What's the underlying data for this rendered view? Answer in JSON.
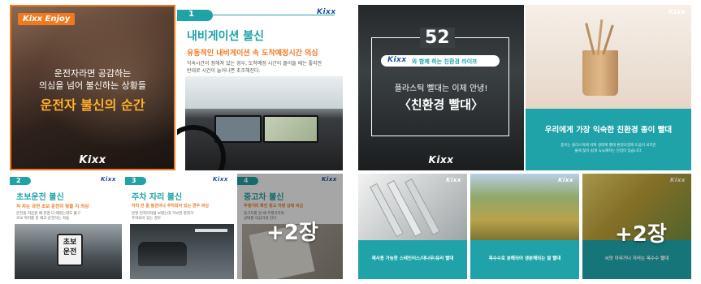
{
  "post_a": {
    "main": {
      "badge": "Kixx Enjoy",
      "subtitle_line1": "운전자라면 공감하는",
      "subtitle_line2": "의심을 넘어 불신하는 상황들",
      "title": "운전자 불신의 순간",
      "logo": "Kixx"
    },
    "card1": {
      "number": "1",
      "logo": "Kixx",
      "title": "내비게이션 불신",
      "highlight": "유동적인 내비게이션 속 도착예정시간 의심",
      "desc_line1": "익숙시간이 정해져 있는 경우, 도착예정 시간이 줄어들 때는 좋지만",
      "desc_line2": "반대로 시간이 늘어나면 초조해진다."
    },
    "card2": {
      "number": "2",
      "logo": "Kixx",
      "title": "초보운전 불신",
      "highlight": "저 차는 과연 초보 운전이 맞을 지 의심",
      "desc_line1": "운전을 처음할 때 분명 다 떼었는데도 불구",
      "desc_line2": "초보 딱지를 못 떼고 운전하는 차들",
      "sticker_line1": "초보",
      "sticker_line2": "운전"
    },
    "card3": {
      "number": "3",
      "logo": "Kixx",
      "title": "주차 자리 불신",
      "highlight": "자리 한 줄 발견이나 주차되어 있는 경우 의심",
      "desc_line1": "분명 빈자리처럼 보였는데 가보면 경차가",
      "desc_line2": "주차되어 있는 경우"
    },
    "card4": {
      "number": "4",
      "logo": "Kixx",
      "title": "중고차 불신",
      "highlight": "주행거리 확인 중고 차량 상태 의심",
      "desc_line1": "중고차를 살 때 주행거리와",
      "desc_line2": "상태를 의심하게 된다",
      "more": "+2장"
    }
  },
  "post_b": {
    "main": {
      "number": "52",
      "brand": "Kixx",
      "series": "와 함께 하는 친환경 라이프",
      "subtitle": "플라스틱 빨대는 이제 안녕!",
      "title": "〈친환경 빨대〉",
      "logo": "Kixx"
    },
    "card1": {
      "logo": "Kixx",
      "title": "우리에게 가장 익숙한 친환경 종이 빨대",
      "desc_line1": "종이는 플라스틱에 비해 생태계 빨대 환경오염에 도움이 되지만",
      "desc_line2": "물에 젖어 쉽게 눅눅해지는 단점이 있습니다."
    },
    "card2": {
      "logo": "Kixx",
      "caption": "재사용 가능한 스테인리스/대나무/유리 빨대"
    },
    "card3": {
      "logo": "Kixx",
      "caption": "옥수수로 분해되어 생분해되는 쌀 빨대"
    },
    "card4": {
      "logo": "Kixx",
      "caption": "씨앗 아무거나 자라는 옥수수 빨대",
      "more": "+2장"
    }
  },
  "colors": {
    "teal": "#1fa3a8",
    "orange": "#f07a22",
    "kixx_blue": "#1e4fa0",
    "headline_orange": "#ffb02a"
  }
}
